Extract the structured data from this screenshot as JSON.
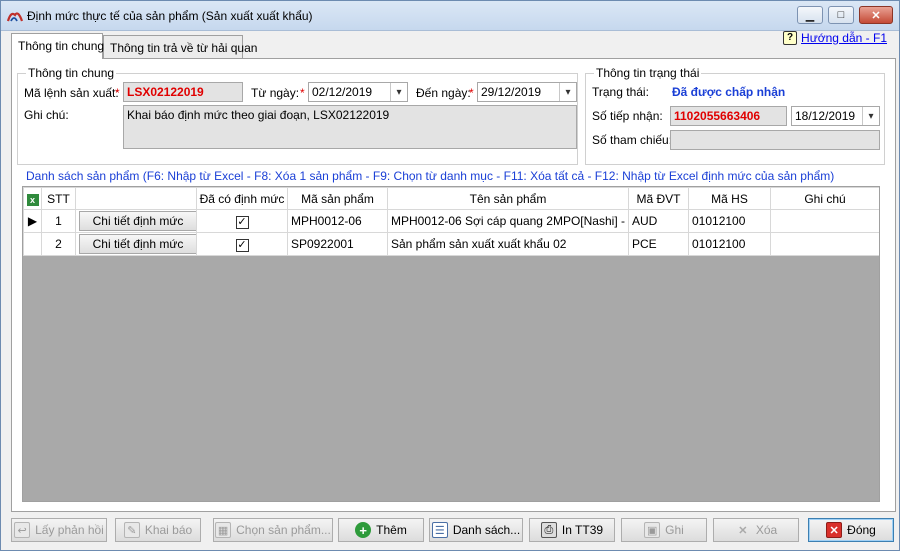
{
  "window": {
    "title": "Định mức thực tế của sản phẩm (Sản xuất xuất khẩu)",
    "controls": {
      "minimize": "▁",
      "maximize": "□",
      "close": "✕"
    }
  },
  "tabs": [
    {
      "label": "Thông tin chung",
      "active": true
    },
    {
      "label": "Thông tin trả về từ hải quan",
      "active": false
    }
  ],
  "help": {
    "label": "Hướng dẫn - F1",
    "icon": "help-icon"
  },
  "general": {
    "title": "Thông tin chung",
    "production_order_label": "Mã lệnh sản xuất:",
    "production_order_value": "LSX02122019",
    "from_date_label": "Từ ngày:",
    "from_date_value": "02/12/2019",
    "to_date_label": "Đến ngày:",
    "to_date_value": "29/12/2019",
    "note_label": "Ghi chú:",
    "note_value": "Khai báo định mức theo giai đoạn, LSX02122019",
    "required_mark": "*"
  },
  "status": {
    "title": "Thông tin trạng thái",
    "state_label": "Trạng thái:",
    "state_value": "Đã được chấp nhận",
    "receipt_no_label": "Số tiếp nhận:",
    "receipt_no_value": "1102055663406",
    "receipt_date_value": "18/12/2019",
    "reference_label": "Số tham chiếu:",
    "reference_value": ""
  },
  "product_list": {
    "title": "Danh sách sản phẩm (F6: Nhập từ Excel - F8: Xóa 1 sản phẩm - F9: Chọn từ danh mục - F11: Xóa tất cả - F12: Nhập từ Excel định mức của sản phẩm)",
    "columns": [
      "STT",
      "",
      "Đã có định mức",
      "Mã sản phẩm",
      "Tên sản phẩm",
      "Mã ĐVT",
      "Mã HS",
      "Ghi chú"
    ],
    "detail_button_label": "Chi tiết định mức",
    "rows": [
      {
        "stt": "1",
        "has_norm": true,
        "code": "MPH0012-06",
        "name": "MPH0012-06 Sợi cáp quang 2MPO[Nashi] - [M",
        "unit": "AUD",
        "hs": "01012100",
        "note": ""
      },
      {
        "stt": "2",
        "has_norm": true,
        "code": "SP0922001",
        "name": "Sản phẩm sản xuất xuất khẩu 02",
        "unit": "PCE",
        "hs": "01012100",
        "note": ""
      }
    ]
  },
  "footer_buttons": [
    {
      "label": "Lấy phản hồi",
      "icon": "feedback-icon",
      "enabled": false
    },
    {
      "label": "Khai báo",
      "icon": "declare-icon",
      "enabled": false
    },
    {
      "label": "Chọn sản phẩm...",
      "icon": "select-product-icon",
      "enabled": false
    },
    {
      "label": "Thêm",
      "icon": "add-icon",
      "enabled": true
    },
    {
      "label": "Danh sách...",
      "icon": "list-icon",
      "enabled": true
    },
    {
      "label": "In TT39",
      "icon": "print-icon",
      "enabled": true
    },
    {
      "label": "Ghi",
      "icon": "save-icon",
      "enabled": false
    },
    {
      "label": "Xóa",
      "icon": "delete-icon",
      "enabled": false
    },
    {
      "label": "Đóng",
      "icon": "close-icon",
      "enabled": true
    }
  ]
}
